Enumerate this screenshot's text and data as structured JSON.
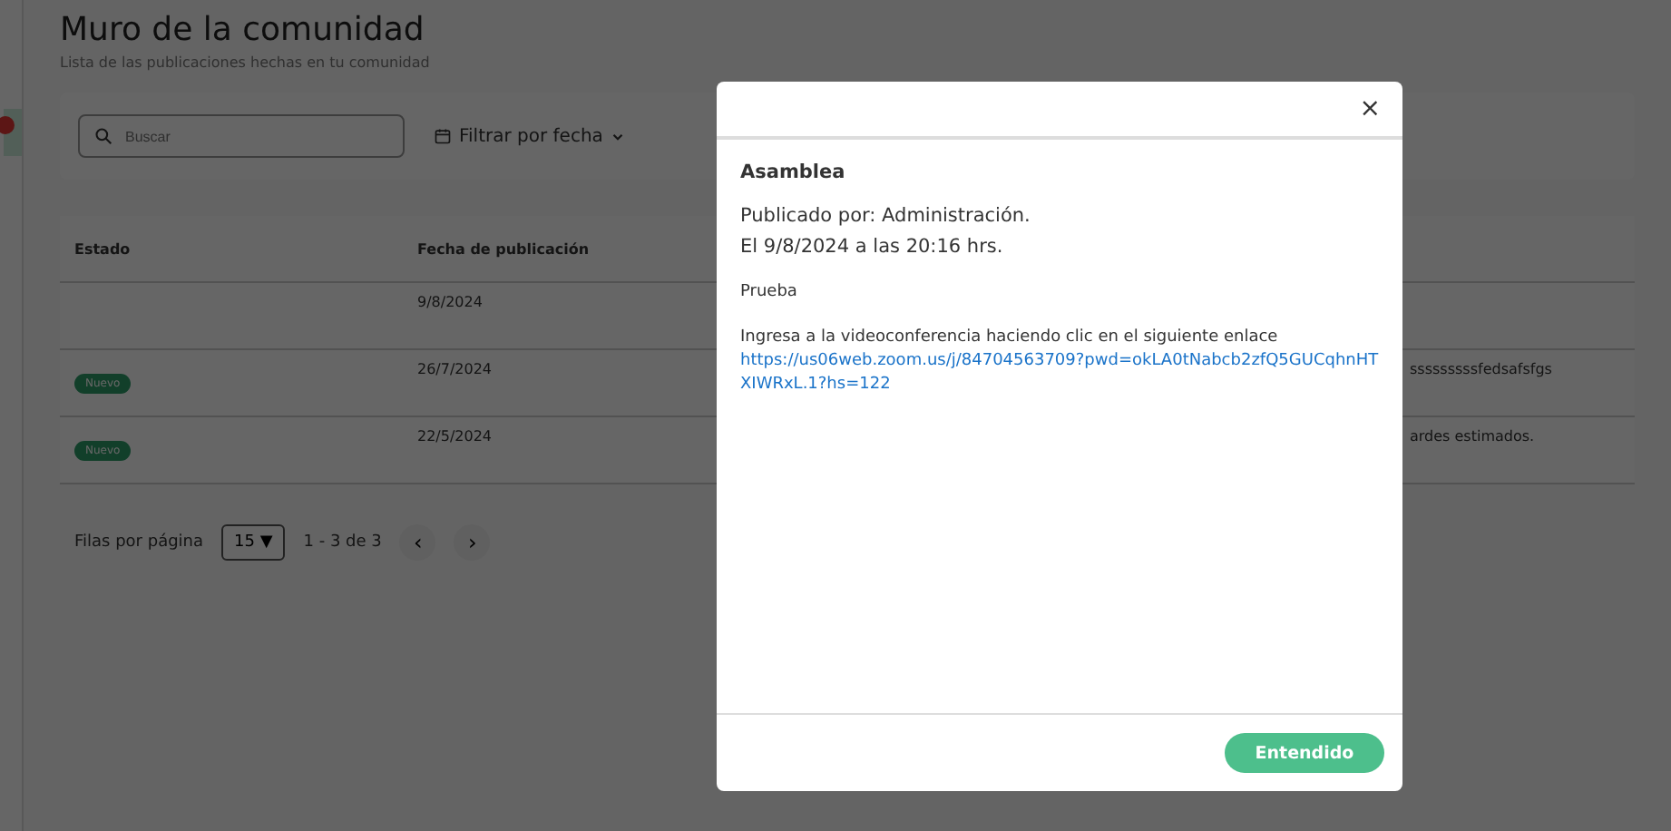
{
  "page": {
    "title": "Muro de la comunidad",
    "subtitle": "Lista de las publicaciones hechas en tu comunidad"
  },
  "filters": {
    "search": {
      "placeholder": "Buscar"
    },
    "date_filter": "Filtrar por fecha"
  },
  "table": {
    "columns": [
      "Estado",
      "Fecha de publicación"
    ],
    "rows": [
      {
        "status": "",
        "date": "9/8/2024"
      },
      {
        "status": "Nuevo",
        "date": "26/7/2024",
        "column_3": "sssssssssfedsafsfgs"
      },
      {
        "status": "Nuevo",
        "date": "22/5/2024",
        "column_3": "ardes estimados."
      }
    ]
  },
  "pagination": {
    "rows_label": "Filas por página",
    "page_size": "15 ▼",
    "range": "1 - 3 de 3",
    "prev": "‹",
    "next": "›"
  },
  "modal": {
    "close": "×",
    "title": "Asamblea",
    "published_by": "Publicado por: Administración.",
    "date_line": "El 9/8/2024 a las 20:16 hrs.",
    "body": "Prueba",
    "invite": "Ingresa a la videoconferencia haciendo clic en el siguiente enlace",
    "link": "https://us06web.zoom.us/j/84704563709?pwd=okLA0tNabcb2zfQ5GUCqhnHTXIWRxL.1?hs=122",
    "button": "Entendido"
  }
}
